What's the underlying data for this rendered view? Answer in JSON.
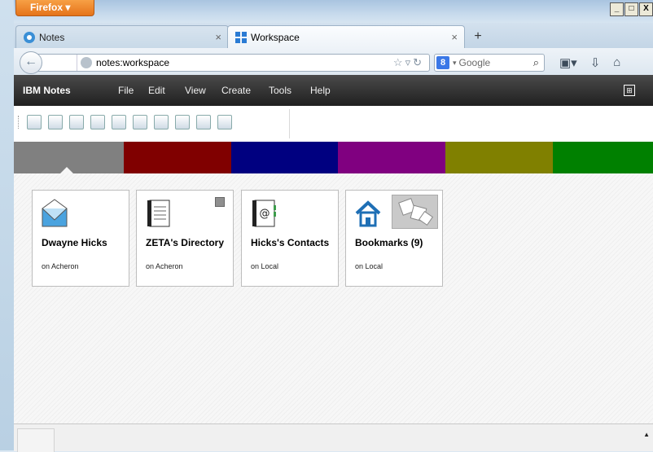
{
  "browser": {
    "menu_button": "Firefox",
    "window_controls": [
      "_",
      "□",
      "X"
    ],
    "tabs": [
      {
        "label": "Notes",
        "active": false
      },
      {
        "label": "Workspace",
        "active": true
      }
    ],
    "new_tab": "+",
    "close_glyph": "×",
    "url": "notes:workspace",
    "search_engine": "Google"
  },
  "notes": {
    "brand": "IBM Notes",
    "menus": [
      "File",
      "Edit",
      "View",
      "Create",
      "Tools",
      "Help"
    ],
    "color_tabs": [
      "#808080",
      "#800000",
      "#000080",
      "#800080",
      "#808000",
      "#008000"
    ],
    "tiles": [
      {
        "title": "Dwayne Hicks",
        "subtitle": "on Acheron",
        "icon": "mail-icon"
      },
      {
        "title": "ZETA's Directory",
        "subtitle": "on Acheron",
        "icon": "directory-icon"
      },
      {
        "title": "Hicks's Contacts",
        "subtitle": "on Local",
        "icon": "contacts-icon"
      },
      {
        "title": "Bookmarks (9)",
        "subtitle": "on Local",
        "icon": "home-icon"
      }
    ]
  }
}
